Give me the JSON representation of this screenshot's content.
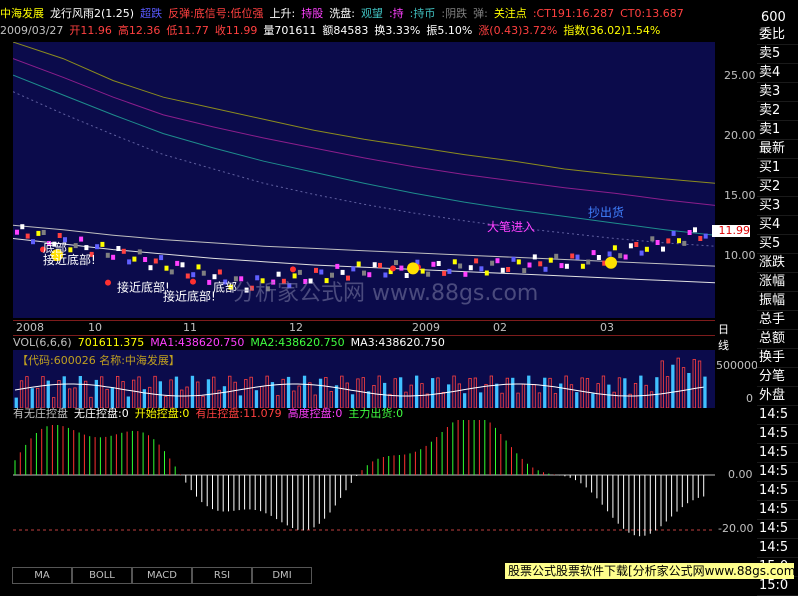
{
  "header": {
    "stock_name": "中海发展",
    "indicator_name": "龙行风雨2(1.25)",
    "tags": [
      {
        "text": "超跌",
        "color": "#5a5aff"
      },
      {
        "text": "反弹:底信号:低位强",
        "color": "#ff4040"
      },
      {
        "text": "上升:",
        "color": "#ffffff"
      },
      {
        "text": "持股",
        "color": "#ff40ff"
      },
      {
        "text": "洗盘:",
        "color": "#ffffff"
      },
      {
        "text": "观望",
        "color": "#40c0c0"
      },
      {
        "text": ":持",
        "color": "#ff40ff"
      },
      {
        "text": ":持币",
        "color": "#40c0c0"
      },
      {
        "text": ":阴跌",
        "color": "#808080"
      },
      {
        "text": "弹:",
        "color": "#808080"
      },
      {
        "text": "关注点",
        "color": "#ffff00"
      },
      {
        "text": ":CT191:16.287",
        "color": "#ff4040"
      },
      {
        "text": "CT0:13.687",
        "color": "#ff4040"
      }
    ],
    "quote_row": [
      {
        "text": "2009/03/27",
        "color": "#c0c0c0"
      },
      {
        "text": "开11.96",
        "color": "#ff4040"
      },
      {
        "text": "高12.36",
        "color": "#ff4040"
      },
      {
        "text": "低11.77",
        "color": "#ff4040"
      },
      {
        "text": "收11.99",
        "color": "#ff4040"
      },
      {
        "text": "量701611",
        "color": "#ffffff"
      },
      {
        "text": "额84583",
        "color": "#ffffff"
      },
      {
        "text": "换3.33%",
        "color": "#ffffff"
      },
      {
        "text": "振5.10%",
        "color": "#ffffff"
      },
      {
        "text": "涨(0.43)3.72%",
        "color": "#ff4040"
      },
      {
        "text": "指数(36.02)1.54%",
        "color": "#ffff00"
      }
    ]
  },
  "main_chart": {
    "y_ticks": [
      "25.00",
      "20.00",
      "15.00",
      "10.00"
    ],
    "current_price": "11.99",
    "annotations": [
      {
        "text": "底部",
        "color": "#ffffff"
      },
      {
        "text": "接近底部!",
        "color": "#ffffff"
      },
      {
        "text": "接近底部!",
        "color": "#ffffff"
      },
      {
        "text": "接近底部!",
        "color": "#ffffff"
      },
      {
        "text": "底部",
        "color": "#ffffff"
      },
      {
        "text": "大笔进入",
        "color": "#ff40ff"
      },
      {
        "text": "抄出货",
        "color": "#4080ff"
      }
    ],
    "watermark": "分析家公式网 www.88gs.com"
  },
  "date_axis": {
    "labels": [
      "2008",
      "10",
      "11",
      "12",
      "2009",
      "02",
      "03"
    ],
    "period": "日线"
  },
  "volume": {
    "title_row": [
      {
        "text": "VOL(6,6,6)",
        "color": "#c0c0c0"
      },
      {
        "text": "701611.375",
        "color": "#ffff00"
      },
      {
        "text": "MA1:438620.750",
        "color": "#ff40ff"
      },
      {
        "text": "MA2:438620.750",
        "color": "#40ff40"
      },
      {
        "text": "MA3:438620.750",
        "color": "#ffffff"
      }
    ],
    "code_label": "【代码:600026  名称:中海发展】",
    "y_ticks": [
      "500000",
      "0"
    ]
  },
  "control_panel": {
    "title_row": [
      {
        "text": "有无庄控盘",
        "color": "#c0c0c0"
      },
      {
        "text": "无庄控盘:0",
        "color": "#ffffff"
      },
      {
        "text": "开始控盘:0",
        "color": "#ffff00"
      },
      {
        "text": "有庄控盘:11.079",
        "color": "#ff4040"
      },
      {
        "text": "高度控盘:0",
        "color": "#ff40ff"
      },
      {
        "text": "主力出货:0",
        "color": "#40ff40"
      }
    ],
    "y_ticks": [
      "0.00",
      "-20.00"
    ]
  },
  "side_panel": {
    "code": "600",
    "items": [
      "委比",
      "卖5",
      "卖4",
      "卖3",
      "卖2",
      "卖1",
      "最新",
      "买1",
      "买2",
      "买3",
      "买4",
      "买5",
      "涨跌",
      "涨幅",
      "振幅",
      "总手",
      "总额",
      "换手",
      "分笔",
      "外盘",
      "14:5",
      "14:5",
      "14:5",
      "14:5",
      "14:5",
      "14:5",
      "14:5",
      "14:5",
      "15:0",
      "15:0"
    ]
  },
  "tabs": [
    "MA",
    "BOLL",
    "MACD",
    "RSI",
    "DMI"
  ],
  "footer_banner": "股票公式股票软件下载[分析家公式网www.88gs.com]",
  "chart_data": {
    "type": "line",
    "title": "中海发展",
    "x": [
      "2008",
      "10",
      "11",
      "12",
      "2009",
      "02",
      "03"
    ],
    "series": [
      {
        "name": "close",
        "values": [
          12.0,
          9.8,
          7.2,
          8.6,
          8.8,
          9.5,
          11.99
        ]
      }
    ],
    "ylim": [
      4,
      29
    ]
  }
}
